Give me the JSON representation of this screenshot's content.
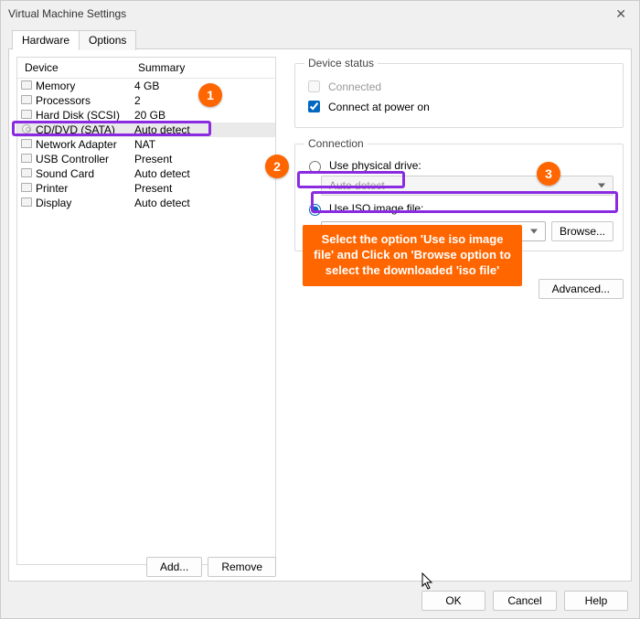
{
  "window": {
    "title": "Virtual Machine Settings"
  },
  "tabs": {
    "hardware": "Hardware",
    "options": "Options"
  },
  "table": {
    "col_device": "Device",
    "col_summary": "Summary",
    "rows": [
      {
        "name": "Memory",
        "summary": "4 GB",
        "icon": "memory"
      },
      {
        "name": "Processors",
        "summary": "2",
        "icon": "cpu"
      },
      {
        "name": "Hard Disk (SCSI)",
        "summary": "20 GB",
        "icon": "hdd"
      },
      {
        "name": "CD/DVD (SATA)",
        "summary": "Auto detect",
        "icon": "cd"
      },
      {
        "name": "Network Adapter",
        "summary": "NAT",
        "icon": "net"
      },
      {
        "name": "USB Controller",
        "summary": "Present",
        "icon": "usb"
      },
      {
        "name": "Sound Card",
        "summary": "Auto detect",
        "icon": "sound"
      },
      {
        "name": "Printer",
        "summary": "Present",
        "icon": "printer"
      },
      {
        "name": "Display",
        "summary": "Auto detect",
        "icon": "display"
      }
    ]
  },
  "buttons": {
    "add": "Add...",
    "remove": "Remove",
    "browse": "Browse...",
    "advanced": "Advanced...",
    "ok": "OK",
    "cancel": "Cancel",
    "help": "Help"
  },
  "device_status": {
    "legend": "Device status",
    "connected": "Connected",
    "connect_at_power_on": "Connect at power on"
  },
  "connection": {
    "legend": "Connection",
    "use_physical": "Use physical drive:",
    "physical_combo": "Auto detect",
    "use_iso": "Use ISO image file:",
    "iso_value": ""
  },
  "annotation": {
    "c1": "1",
    "c2": "2",
    "c3": "3",
    "tip": "Select the option 'Use iso image file' and Click on 'Browse option to select the downloaded 'iso file'"
  }
}
